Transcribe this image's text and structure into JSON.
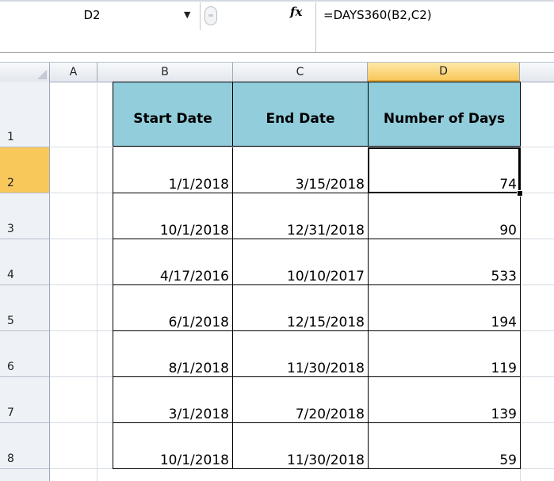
{
  "formula_bar": {
    "name_box": "D2",
    "fx_label": "fx",
    "formula": "=DAYS360(B2,C2)"
  },
  "columns": [
    "A",
    "B",
    "C",
    "D"
  ],
  "rows": [
    "1",
    "2",
    "3",
    "4",
    "5",
    "6",
    "7",
    "8"
  ],
  "table": {
    "headers": [
      "Start Date",
      "End Date",
      "Number of Days"
    ],
    "rows": [
      [
        "1/1/2018",
        "3/15/2018",
        "74"
      ],
      [
        "10/1/2018",
        "12/31/2018",
        "90"
      ],
      [
        "4/17/2016",
        "10/10/2017",
        "533"
      ],
      [
        "6/1/2018",
        "12/15/2018",
        "194"
      ],
      [
        "8/1/2018",
        "11/30/2018",
        "119"
      ],
      [
        "3/1/2018",
        "7/20/2018",
        "139"
      ],
      [
        "10/1/2018",
        "11/30/2018",
        "59"
      ]
    ]
  },
  "colors": {
    "header_fill": "#92cddc",
    "active_header": "#f9c85b"
  }
}
